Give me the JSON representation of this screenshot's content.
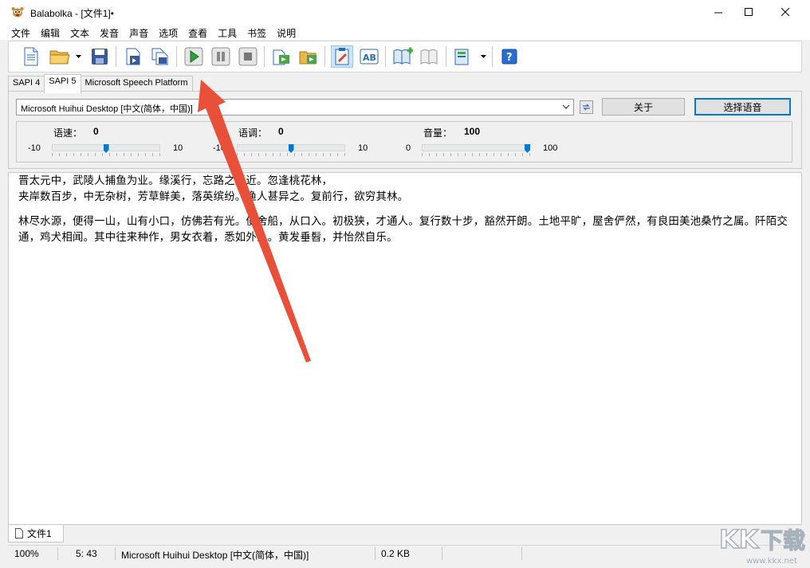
{
  "window": {
    "title": "Balabolka - [文件1]•"
  },
  "menu": [
    "文件",
    "编辑",
    "文本",
    "发音",
    "声音",
    "选项",
    "查看",
    "工具",
    "书签",
    "说明"
  ],
  "toolbar": {
    "buttons": [
      "new-document-icon",
      "open-folder-icon",
      "save-icon",
      "save-audio-icon",
      "batch-convert-icon",
      "play-icon",
      "pause-icon",
      "stop-icon",
      "convert-clipboard-icon",
      "open-files-icon",
      "read-clipboard-icon",
      "spell-icon",
      "add-bookmark-icon",
      "bookmarks-icon",
      "dictionary-icon",
      "help-icon"
    ],
    "active": "read-clipboard-icon"
  },
  "tabs": {
    "sapi4": "SAPI 4",
    "sapi5": "SAPI 5",
    "msp": "Microsoft Speech Platform",
    "selected": "SAPI 5"
  },
  "voice": {
    "selected": "Microsoft Huihui Desktop [中文(简体，中国)]",
    "about_label": "关于",
    "select_label": "选择语音"
  },
  "sliders": {
    "rate": {
      "label": "语速：",
      "value": "0",
      "min": "-10",
      "max": "10",
      "level": 0.5
    },
    "pitch": {
      "label": "语调：",
      "value": "0",
      "min": "-10",
      "max": "10",
      "level": 0.5
    },
    "volume": {
      "label": "音量：",
      "value": "100",
      "min": "0",
      "max": "100",
      "level": 1.0
    }
  },
  "editor": {
    "paragraph1": "晋太元中，武陵人捕鱼为业。缘溪行，忘路之远近。忽逢桃花林，\n夹岸数百步，中无杂树，芳草鲜美，落英缤纷。渔人甚异之。复前行，欲穷其林。",
    "paragraph2": "林尽水源，便得一山，山有小口，仿佛若有光。便舍船，从口入。初极狭，才通人。复行数十步，豁然开朗。土地平旷，屋舍俨然，有良田美池桑竹之属。阡陌交通，鸡犬相闻。其中往来种作，男女衣着，悉如外人。黄发垂髫，并怡然自乐。"
  },
  "doc_tab": {
    "label": "文件1"
  },
  "status": {
    "zoom": "100%",
    "position": "5:  43",
    "voice": "Microsoft Huihui Desktop [中文(简体，中国)]",
    "size": "0.2 KB"
  },
  "watermark": {
    "text": "KK下载",
    "url": "www.kkx.net"
  },
  "colors": {
    "accent": "#0078d7",
    "arrow": "#e8503a",
    "play": "#2e9d3a"
  }
}
